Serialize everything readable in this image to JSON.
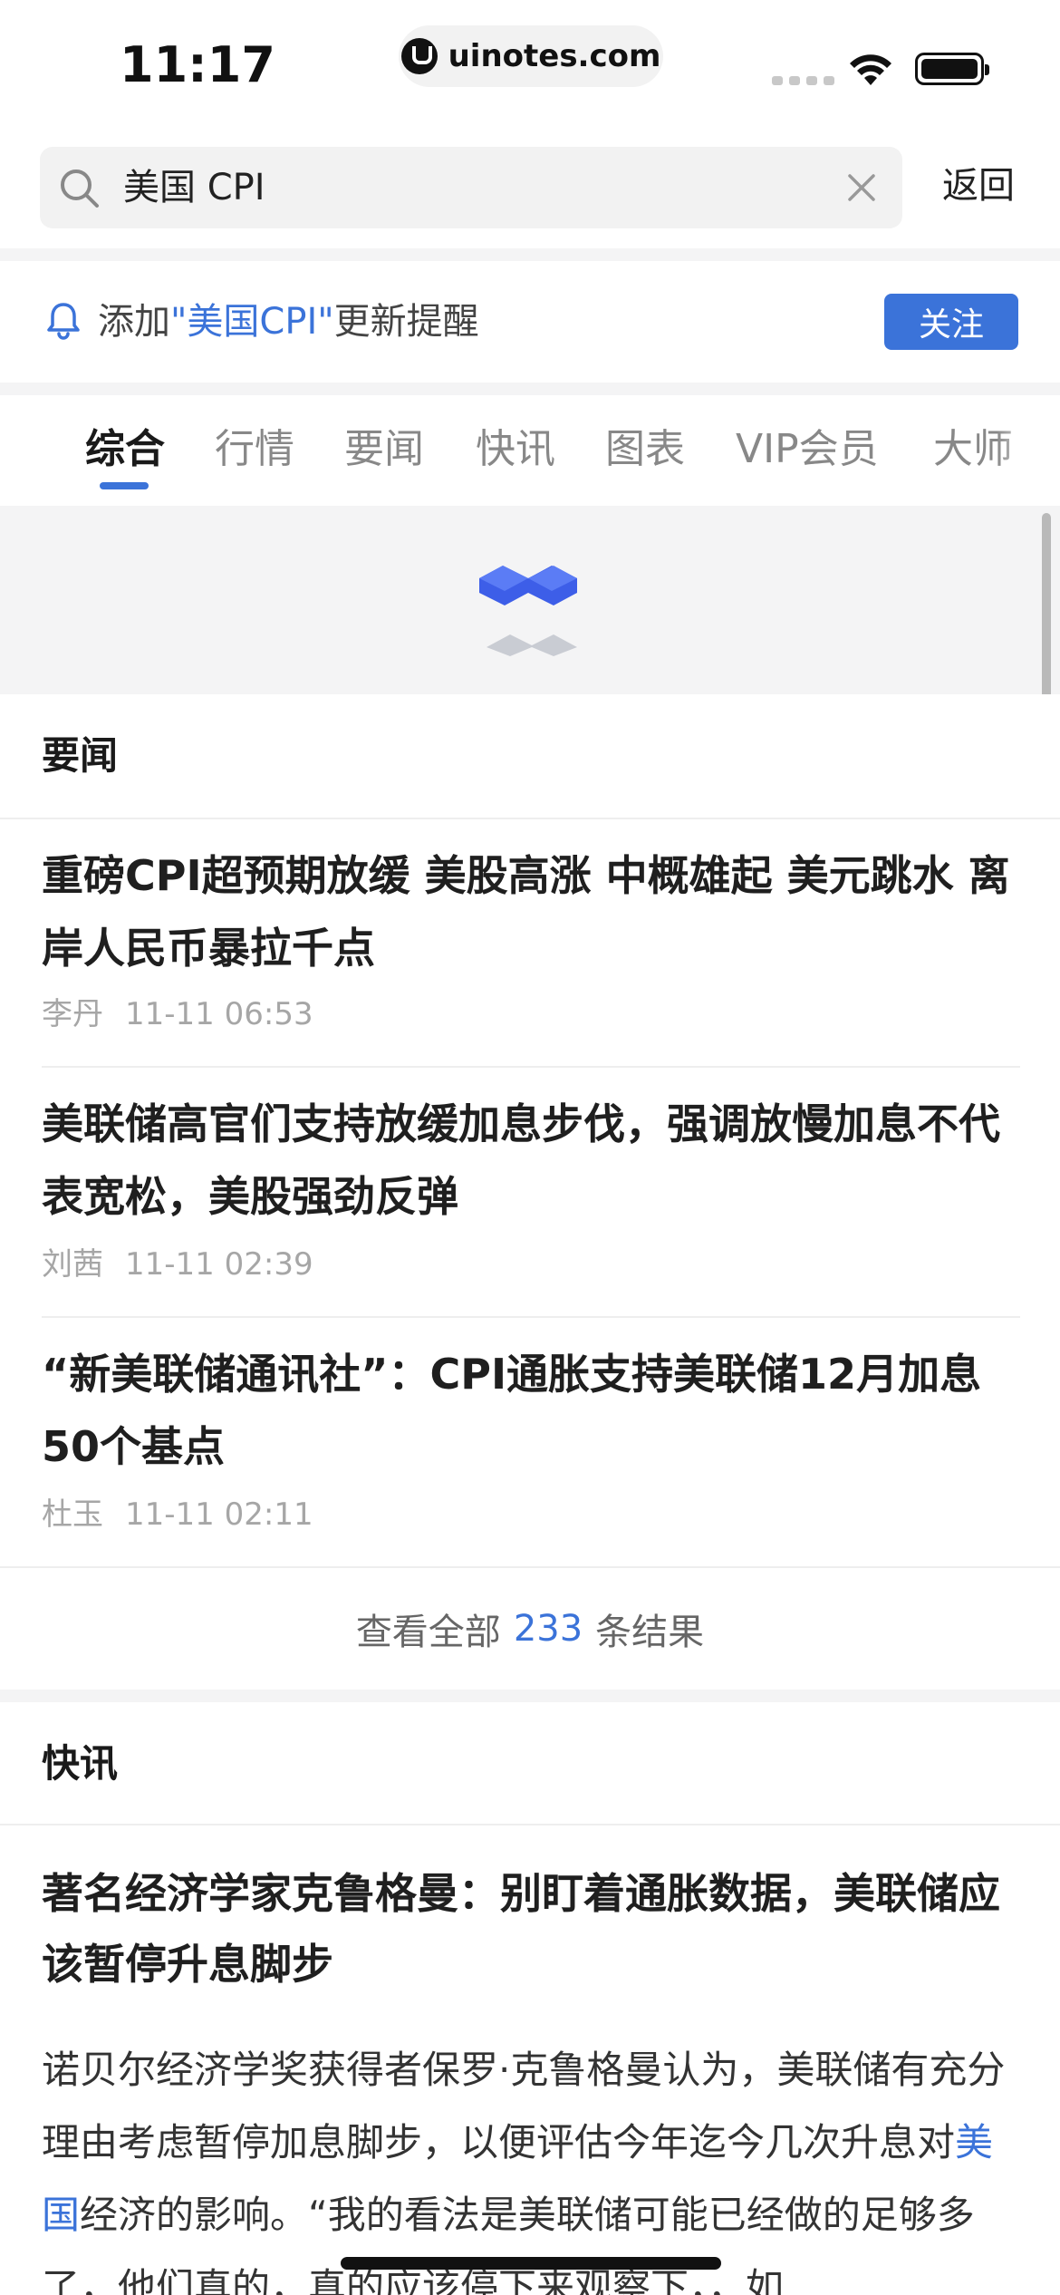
{
  "status_bar": {
    "time": "11:17",
    "url": "uinotes.com"
  },
  "search": {
    "query": "美国 CPI",
    "back_label": "返回"
  },
  "reminder": {
    "prefix": "添加",
    "keyword": "\"美国CPI\"",
    "suffix": "更新提醒",
    "follow_label": "关注"
  },
  "tabs": [
    {
      "label": "综合",
      "active": true
    },
    {
      "label": "行情",
      "active": false
    },
    {
      "label": "要闻",
      "active": false
    },
    {
      "label": "快讯",
      "active": false
    },
    {
      "label": "图表",
      "active": false
    },
    {
      "label": "VIP会员",
      "active": false
    },
    {
      "label": "大师",
      "active": false
    }
  ],
  "news_section": {
    "title": "要闻",
    "items": [
      {
        "title": "重磅CPI超预期放缓 美股高涨 中概雄起 美元跳水 离岸人民币暴拉千点",
        "author": "李丹",
        "time": "11-11 06:53"
      },
      {
        "title": "美联储高官们支持放缓加息步伐，强调放慢加息不代表宽松，美股强劲反弹",
        "author": "刘茜",
        "time": "11-11 02:39"
      },
      {
        "title": "“新美联储通讯社”：CPI通胀支持美联储12月加息50个基点",
        "author": "杜玉",
        "time": "11-11 02:11"
      }
    ],
    "view_all_prefix": "查看全部",
    "view_all_count": "233",
    "view_all_suffix": "条结果"
  },
  "flash_section": {
    "title": "快讯",
    "item_title": "著名经济学家克鲁格曼：别盯着通胀数据，美联储应该暂停升息脚步",
    "body_before_link": "诺贝尔经济学奖获得者保罗·克鲁格曼认为，美联储有充分理由考虑暂停加息脚步，以便评估今年迄今几次升息对",
    "body_link": "美国",
    "body_after_link": "经济的影响。“我的看法是美联储可能已经做的足够多了，他们真的，真的应该停下来观察下，，如"
  },
  "colors": {
    "accent": "#3b73d9",
    "background_gap": "#f4f4f5",
    "meta_text": "#a6a6a6"
  }
}
